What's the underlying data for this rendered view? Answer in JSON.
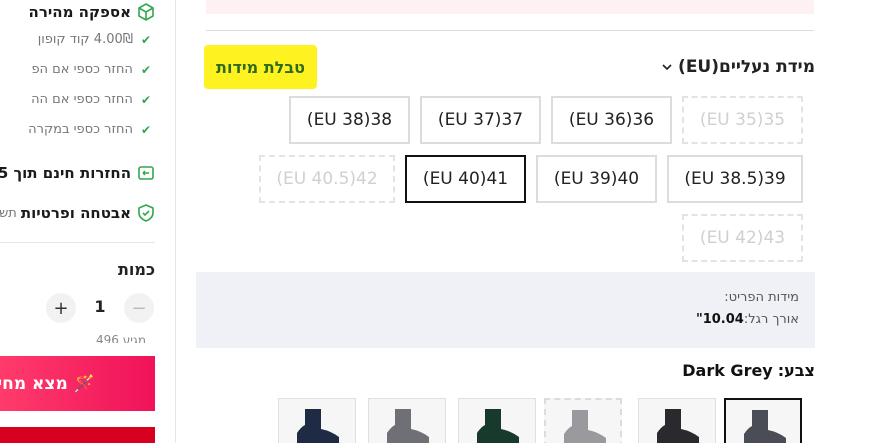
{
  "sidebar": {
    "fast_delivery": "אספקה מהירה",
    "coupon_line": "4.00₪ קוד קופון",
    "refund_lines": [
      "החזר כספי אם הפ",
      "החזר כספי אם הה",
      "החזר כספי במקרה"
    ],
    "free_returns": "החזרות חינם תוך 5",
    "privacy": "אבטחה ופרטיות",
    "privacy_tail": "תש",
    "quantity_label": "כמות",
    "quantity_value": "1",
    "quantity_minus": "−",
    "quantity_plus": "+",
    "quantity_note_cut": "496 מגיע",
    "find_button": "מצא מחי",
    "find_icon": "🪄"
  },
  "size": {
    "header": "מידת נעליים(EU)",
    "size_chart_link": "טבלת מידות",
    "options_row1": [
      "35(EU 35)",
      "36(EU 36)",
      "37(EU 37)",
      "38(EU 38)"
    ],
    "options_row2": [
      "39(EU 38.5)",
      "40(EU 39)",
      "41(EU 40)",
      "42(EU 40.5)"
    ],
    "options_row3": [
      "43(EU 42)"
    ],
    "selected": "41(EU 40)",
    "unavailable": [
      "35(EU 35)",
      "42(EU 40.5)",
      "43(EU 42)"
    ]
  },
  "details": {
    "title": "מידות הפריט:",
    "foot_length_label": "אורך רגל:",
    "foot_length_value": "10.04\""
  },
  "color": {
    "label": "צבע:",
    "value": "Dark Grey",
    "swatches": [
      "dark-grey",
      "black",
      "light-grey",
      "dark-green",
      "grey",
      "navy"
    ],
    "swatch_colors": [
      "#4a4d55",
      "#2a2a2e",
      "#9a9a9e",
      "#173a2c",
      "#6f7075",
      "#1f2a44"
    ]
  },
  "colors": {
    "highlight": "#fff221",
    "check": "#2fa84f",
    "cta_gradient_start": "#ff3b6b",
    "cta_gradient_end": "#f0125a",
    "buy_red": "#d80020"
  }
}
